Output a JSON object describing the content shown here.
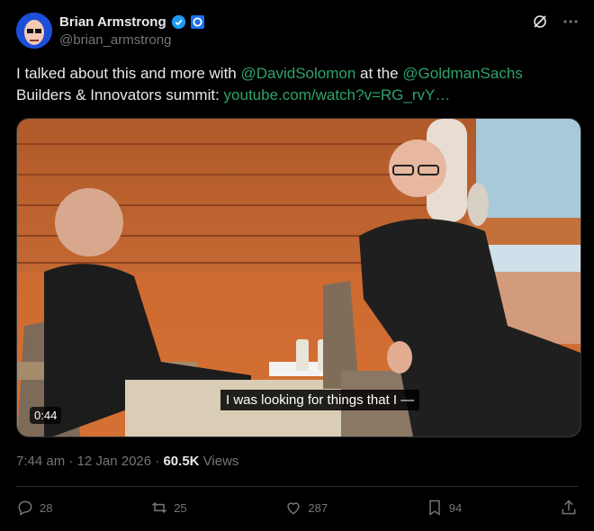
{
  "author": {
    "name": "Brian Armstrong",
    "handle": "@brian_armstrong"
  },
  "tweet": {
    "text_parts": [
      {
        "text": "I talked about this and more with ",
        "link": false
      },
      {
        "text": "@DavidSolomon",
        "link": true
      },
      {
        "text": " at the ",
        "link": false
      },
      {
        "text": "@GoldmanSachs",
        "link": true
      },
      {
        "text": " Builders & Innovators summit: ",
        "link": false
      },
      {
        "text": "youtube.com/watch?v=RG_rvY…",
        "link": true
      }
    ]
  },
  "video": {
    "caption": "I was looking for things that I —",
    "duration": "0:44"
  },
  "meta": {
    "time": "7:44 am",
    "date": "12 Jan 2026",
    "views_count": "60.5K",
    "views_label": "Views"
  },
  "stats": {
    "replies": "28",
    "reposts": "25",
    "likes": "287",
    "bookmarks": "94"
  },
  "colors": {
    "link": "#2ea36b",
    "background": "#000000",
    "verified": "#1d9bf0"
  },
  "icons": [
    "verified-badge-icon",
    "affiliate-badge-icon",
    "grok-icon",
    "more-icon",
    "reply-icon",
    "repost-icon",
    "like-icon",
    "bookmark-icon",
    "share-icon"
  ]
}
